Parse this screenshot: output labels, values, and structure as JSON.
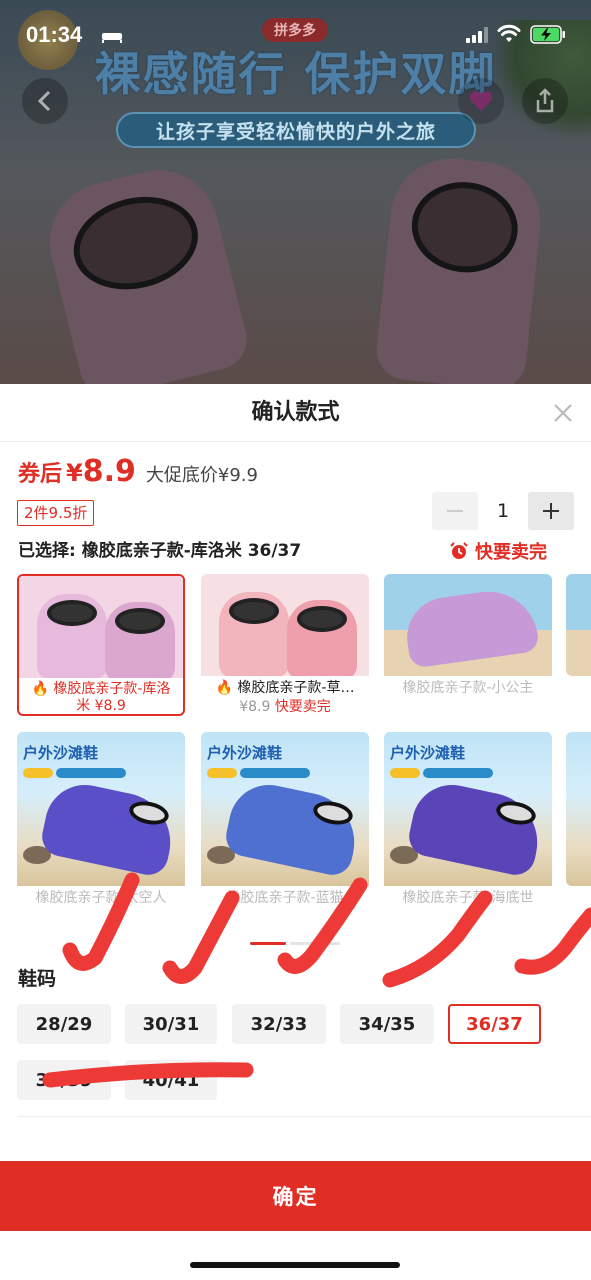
{
  "status_bar": {
    "time": "01:34"
  },
  "banner": {
    "brand_badge": "拼多多",
    "headline": "裸感随行 保护双脚",
    "subline": "让孩子享受轻松愉快的户外之旅"
  },
  "sheet": {
    "title": "确认款式",
    "coupon_label": "券后",
    "currency": "¥",
    "price": "8.9",
    "promo_price": "大促底价¥9.9",
    "discount_tag": "2件9.5折",
    "quantity": "1",
    "selected_text": "已选择: 橡胶底亲子款-库洛米 36/37",
    "selling_fast": "快要卖完"
  },
  "styles": [
    {
      "name": "橡胶底亲子款-库洛米",
      "price": "¥8.9",
      "selected": true
    },
    {
      "name": "橡胶底亲子款-草…",
      "price": "¥8.9",
      "note": "快要卖完"
    },
    {
      "name": "橡胶底亲子款-小公主"
    },
    {
      "name": "橡胶底亲子款-太空人",
      "banner": "户外沙滩鞋"
    },
    {
      "name": "橡胶底亲子款-蓝猫",
      "banner": "户外沙滩鞋"
    },
    {
      "name": "橡胶底亲子款-海底世",
      "banner": "户外沙滩鞋"
    }
  ],
  "size_section": {
    "title": "鞋码",
    "sizes": [
      "28/29",
      "30/31",
      "32/33",
      "34/35",
      "36/37",
      "38/39",
      "40/41"
    ],
    "selected": "36/37"
  },
  "confirm_label": "确定",
  "colors": {
    "accent": "#e02e24",
    "chip_bg": "#f2f2f2"
  }
}
